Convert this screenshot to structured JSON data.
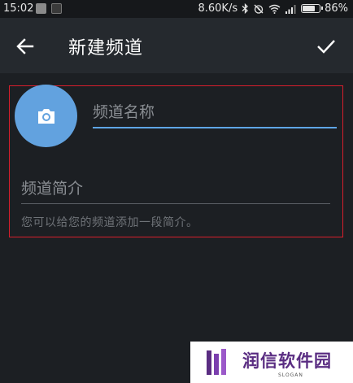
{
  "status_bar": {
    "time": "15:02",
    "network_speed": "8.60K/s",
    "battery_level": 0.86,
    "battery_text": "86%",
    "icons": [
      "app-icon",
      "app-icon",
      "bluetooth-icon",
      "alarm-off-icon",
      "wifi-icon",
      "signal-icon",
      "battery-icon"
    ]
  },
  "app_bar": {
    "back_icon": "arrow-left-icon",
    "title": "新建频道",
    "done_icon": "check-icon"
  },
  "form": {
    "avatar_icon": "camera-icon",
    "avatar_color": "#62a2df",
    "name_placeholder": "频道名称",
    "name_value": "",
    "description_placeholder": "频道简介",
    "description_value": "",
    "hint": "您可以给您的频道添加一段简介。",
    "accent_color": "#5ea5e6",
    "highlight_border_color": "#d81e2c"
  },
  "watermark": {
    "brand": "润信软件园",
    "slogan": "SLOGAN"
  }
}
